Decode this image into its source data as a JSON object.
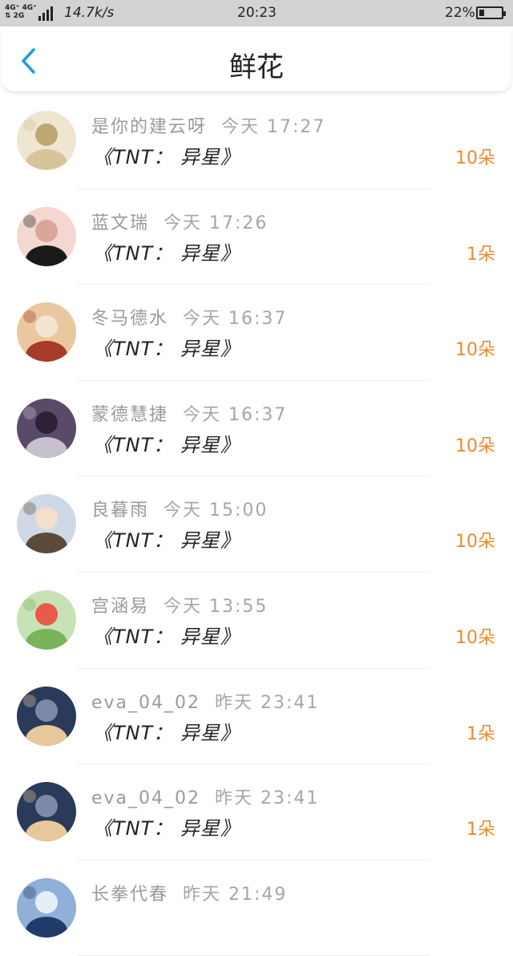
{
  "status_bar": {
    "network_line1": "4G⁺ 4G⁺",
    "network_line2": "⇅ 2G",
    "speed": "14.7k/s",
    "time": "20:23",
    "battery_percent": "22%",
    "battery_level": 0.22
  },
  "nav": {
    "title": "鲜花",
    "back_icon": "chevron-left-icon"
  },
  "colors": {
    "accent_blue": "#1e9be0",
    "count_orange": "#f0882c",
    "name_gray": "#9a9a9a"
  },
  "gifts": [
    {
      "name": "是你的建云呀",
      "time": "今天 17:27",
      "book": "《TNT： 异星》",
      "count": "10朵"
    },
    {
      "name": "蓝文瑞",
      "time": "今天 17:26",
      "book": "《TNT： 异星》",
      "count": "1朵"
    },
    {
      "name": "冬马德水",
      "time": "今天 16:37",
      "book": "《TNT： 异星》",
      "count": "10朵"
    },
    {
      "name": "蒙德慧捷",
      "time": "今天 16:37",
      "book": "《TNT： 异星》",
      "count": "10朵"
    },
    {
      "name": "良暮雨",
      "time": "今天 15:00",
      "book": "《TNT： 异星》",
      "count": "10朵"
    },
    {
      "name": "宫涵易",
      "time": "今天 13:55",
      "book": "《TNT： 异星》",
      "count": "10朵"
    },
    {
      "name": "eva_04_02",
      "time": "昨天 23:41",
      "book": "《TNT： 异星》",
      "count": "1朵"
    },
    {
      "name": "eva_04_02",
      "time": "昨天 23:41",
      "book": "《TNT： 异星》",
      "count": "1朵"
    },
    {
      "name": "长拳代春",
      "time": "昨天 21:49",
      "book": "",
      "count": ""
    }
  ]
}
